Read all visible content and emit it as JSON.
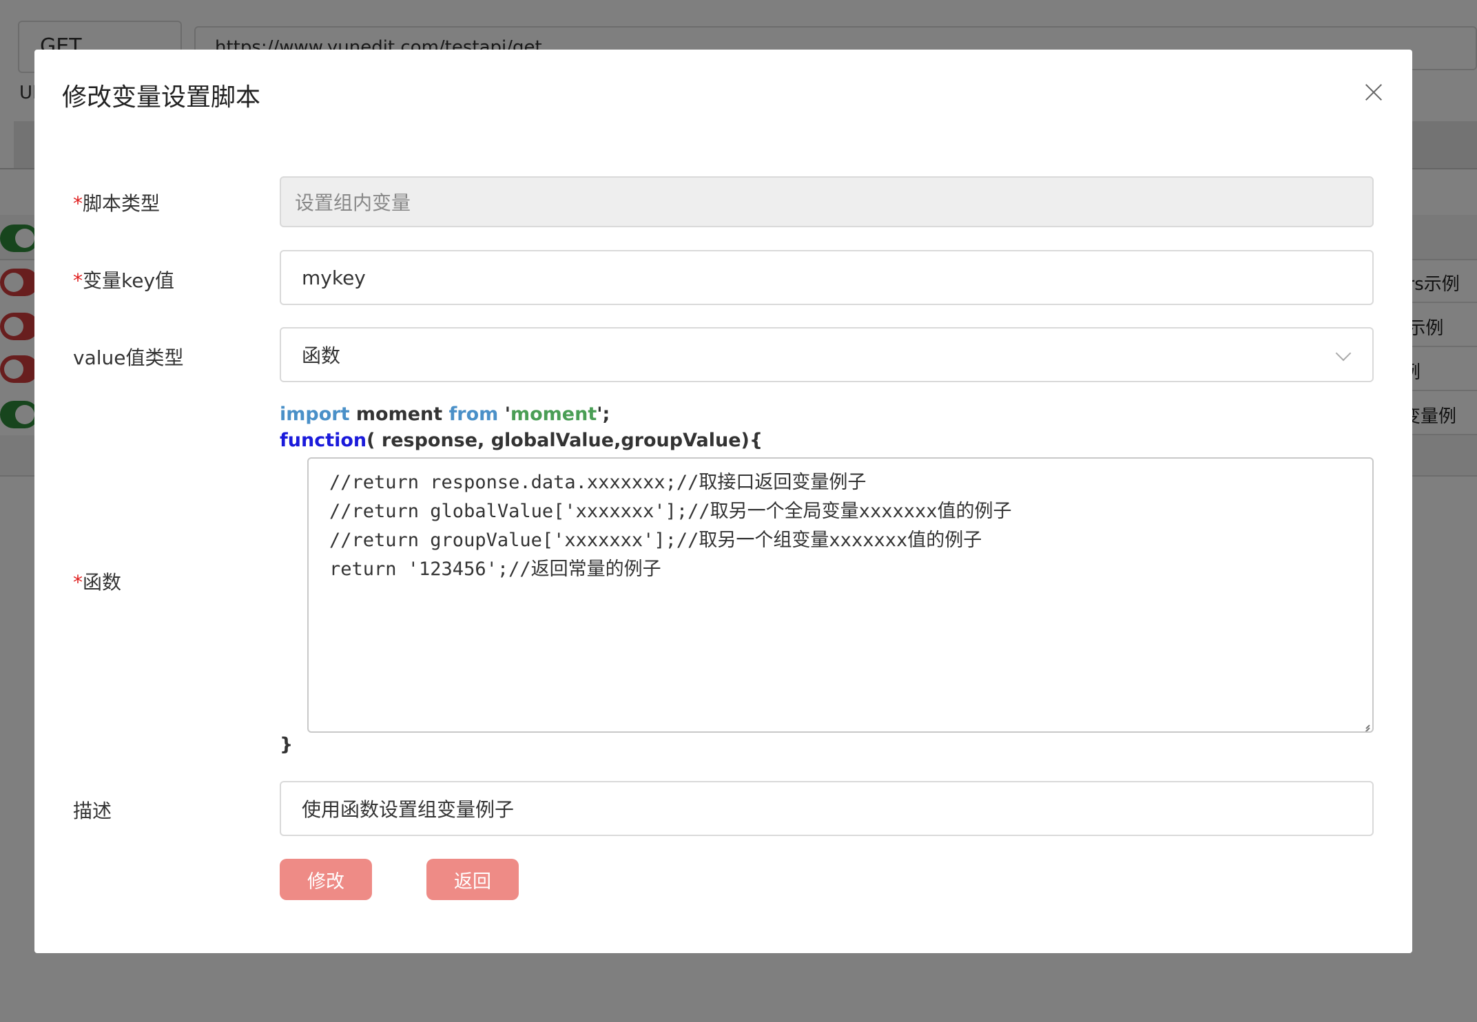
{
  "background": {
    "method": "GET",
    "url": "https://www.yunedit.com/testapi/get",
    "url_label": "Ul",
    "rows": [
      "ders示例",
      "tie示例",
      "示例",
      "组变量例"
    ]
  },
  "modal": {
    "title": "修改变量设置脚本",
    "fields": {
      "script_type": {
        "required_mark": "*",
        "label": "脚本类型",
        "value": "设置组内变量"
      },
      "var_key": {
        "required_mark": "*",
        "label": "变量key值",
        "value": "mykey"
      },
      "value_type": {
        "label": "value值类型",
        "value": "函数"
      },
      "function": {
        "required_mark": "*",
        "label": "函数",
        "header_import_kw": "import",
        "header_import_name": " moment ",
        "header_from_kw": "from",
        "header_quote_open": " '",
        "header_module": "moment",
        "header_quote_close": "';",
        "header_function_kw": "function",
        "header_params": "( response, globalValue,groupValue){",
        "body": "//return response.data.xxxxxxx;//取接口返回变量例子\n//return globalValue['xxxxxxx'];//取另一个全局变量xxxxxxx值的例子\n//return groupValue['xxxxxxx'];//取另一个组变量xxxxxxx值的例子\nreturn '123456';//返回常量的例子",
        "closing_brace": "}"
      },
      "description": {
        "label": "描述",
        "value": "使用函数设置组变量例子"
      }
    },
    "buttons": {
      "submit": "修改",
      "back": "返回"
    }
  }
}
